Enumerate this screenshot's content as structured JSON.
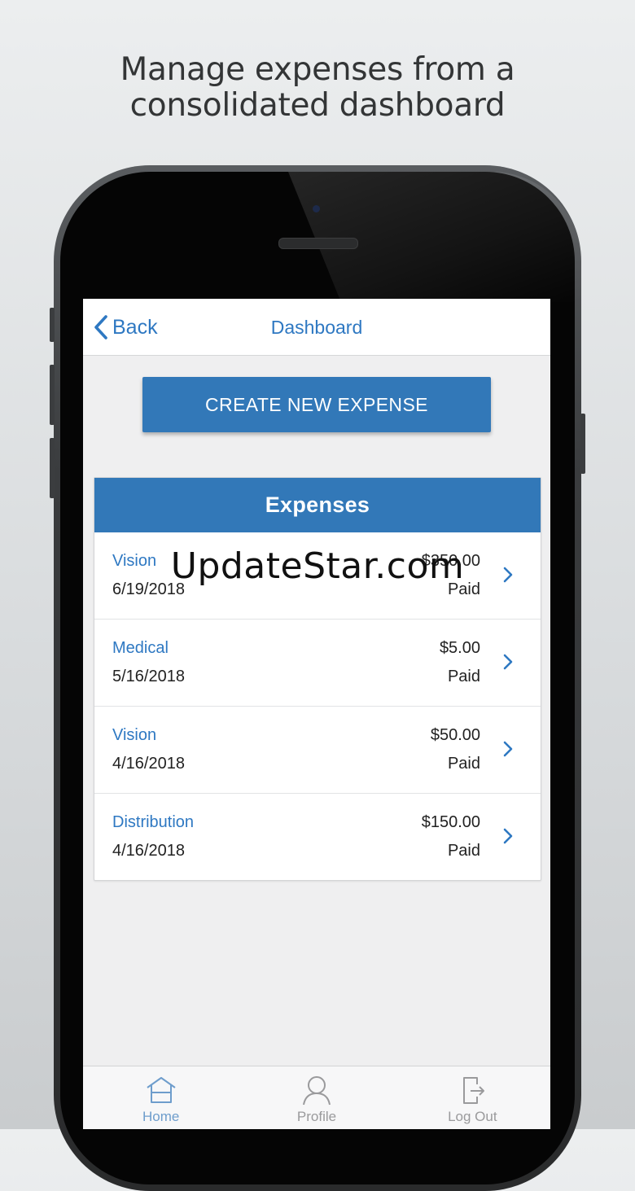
{
  "headline": {
    "line1": "Manage expenses from a",
    "line2": "consolidated dashboard"
  },
  "navbar": {
    "back_label": "Back",
    "title": "Dashboard"
  },
  "create_button": {
    "label": "CREATE NEW EXPENSE"
  },
  "expenses": {
    "header": "Expenses",
    "rows": [
      {
        "category": "Vision",
        "date": "6/19/2018",
        "amount": "$350.00",
        "status": "Paid"
      },
      {
        "category": "Medical",
        "date": "5/16/2018",
        "amount": "$5.00",
        "status": "Paid"
      },
      {
        "category": "Vision",
        "date": "4/16/2018",
        "amount": "$50.00",
        "status": "Paid"
      },
      {
        "category": "Distribution",
        "date": "4/16/2018",
        "amount": "$150.00",
        "status": "Paid"
      }
    ]
  },
  "tabbar": {
    "items": [
      {
        "label": "Home",
        "icon": "home-icon",
        "active": true
      },
      {
        "label": "Profile",
        "icon": "profile-icon",
        "active": false
      },
      {
        "label": "Log Out",
        "icon": "logout-icon",
        "active": false
      }
    ]
  },
  "watermark": {
    "text": "UpdateStar.com"
  },
  "colors": {
    "accent": "#3278b8",
    "link": "#2e78c2",
    "tab_active": "#6e9dcc",
    "tab_inactive": "#9a9a9c"
  }
}
